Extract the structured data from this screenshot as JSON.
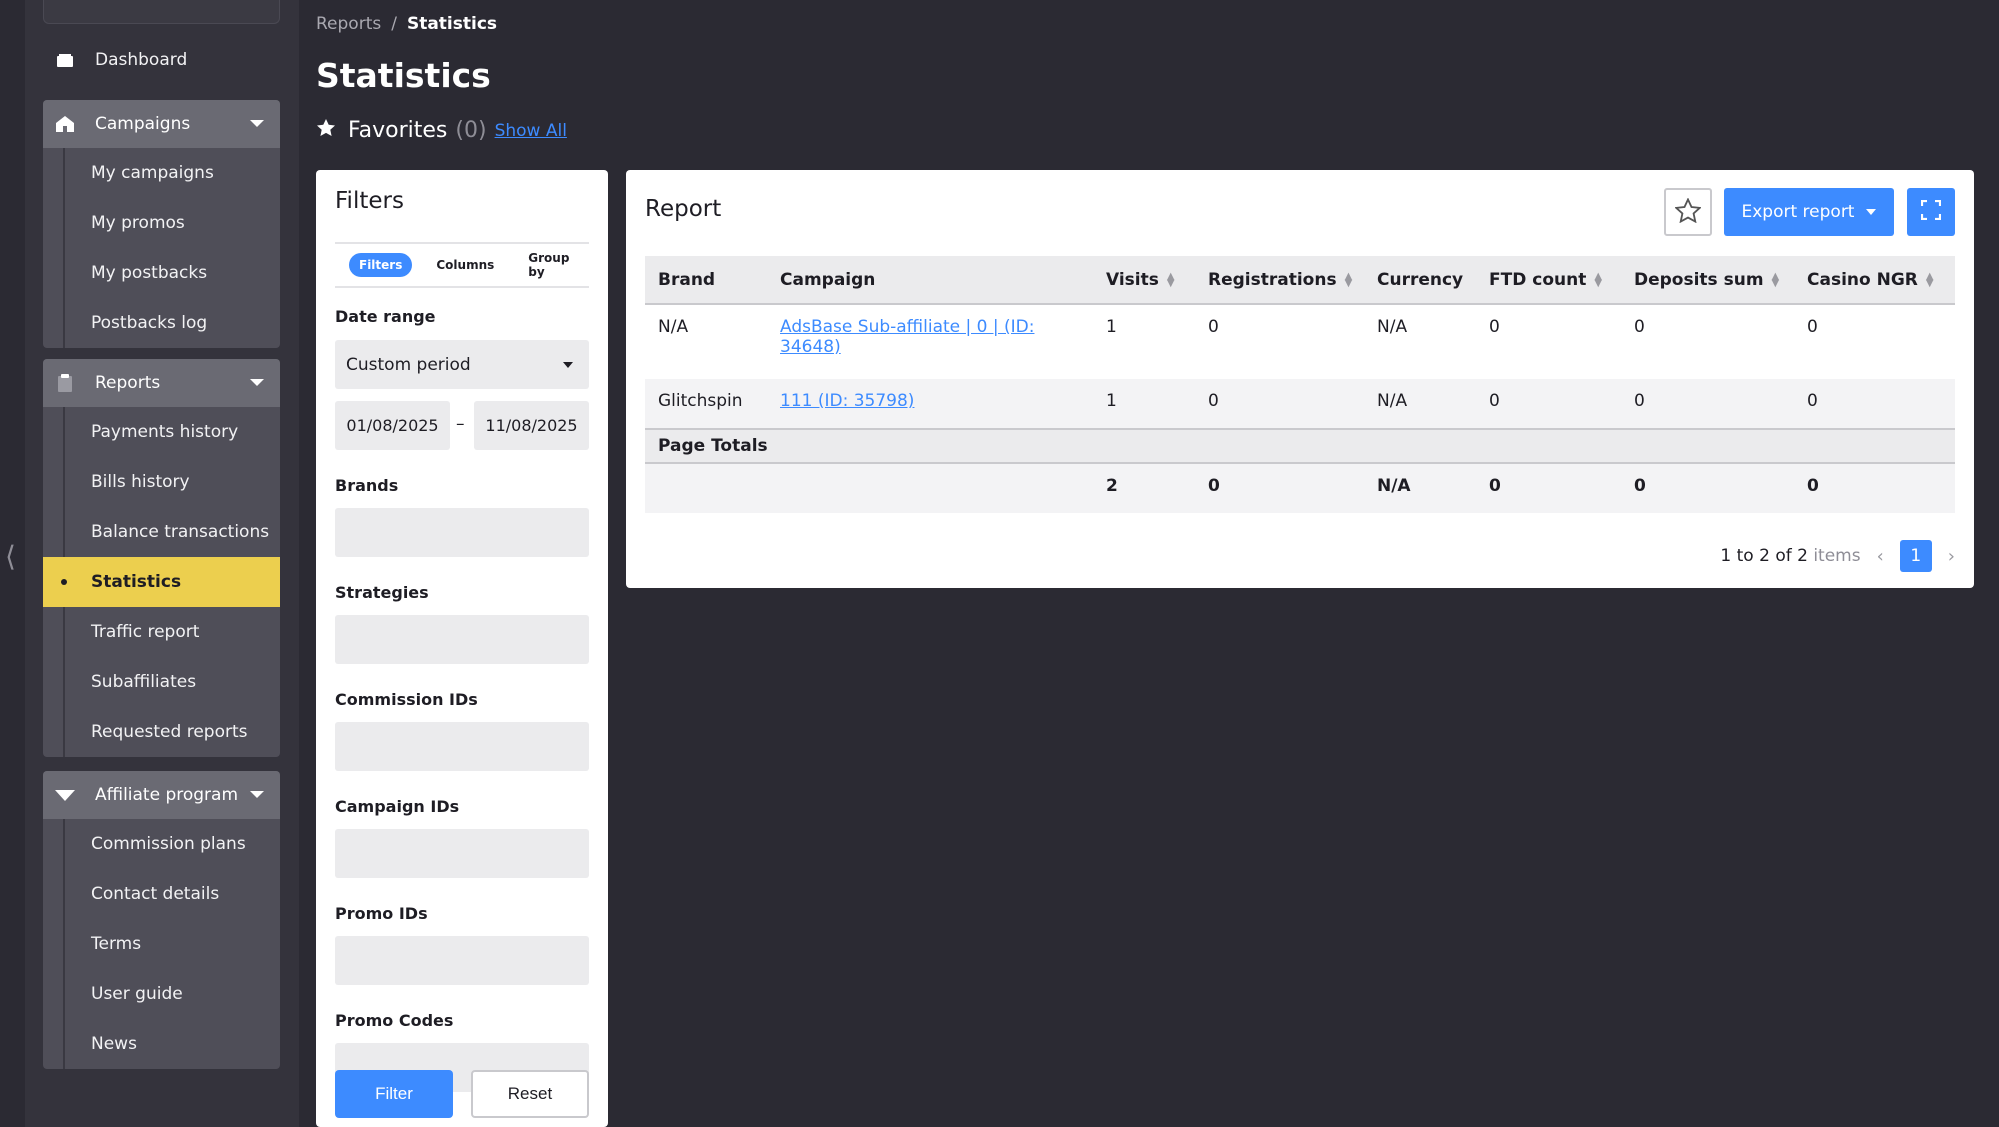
{
  "sidebar": {
    "dashboard": "Dashboard",
    "campaigns": {
      "label": "Campaigns",
      "items": [
        "My campaigns",
        "My promos",
        "My postbacks",
        "Postbacks log"
      ]
    },
    "reports": {
      "label": "Reports",
      "items": [
        "Payments history",
        "Bills history",
        "Balance transactions",
        "Statistics",
        "Traffic report",
        "Subaffiliates",
        "Requested reports"
      ]
    },
    "affiliate": {
      "label": "Affiliate program",
      "items": [
        "Commission plans",
        "Contact details",
        "Terms",
        "User guide",
        "News"
      ]
    }
  },
  "breadcrumb": {
    "parent": "Reports",
    "sep": "/",
    "current": "Statistics"
  },
  "page_title": "Statistics",
  "favorites": {
    "label": "Favorites",
    "count": "(0)",
    "show_all": "Show All"
  },
  "filters": {
    "title": "Filters",
    "tabs": [
      "Filters",
      "Columns",
      "Group by"
    ],
    "date_range_label": "Date range",
    "date_range_value": "Custom period",
    "date_from": "01/08/2025",
    "date_sep": "–",
    "date_to": "11/08/2025",
    "brands_label": "Brands",
    "strategies_label": "Strategies",
    "commission_ids_label": "Commission IDs",
    "campaign_ids_label": "Campaign IDs",
    "promo_ids_label": "Promo IDs",
    "promo_codes_label": "Promo Codes",
    "filter_button": "Filter",
    "reset_button": "Reset"
  },
  "report": {
    "title": "Report",
    "export_label": "Export report",
    "columns": [
      "Brand",
      "Campaign",
      "Visits",
      "Registrations",
      "Currency",
      "FTD count",
      "Deposits sum",
      "Casino NGR"
    ],
    "rows": [
      {
        "brand": "N/A",
        "campaign": "AdsBase Sub-affiliate | 0 | (ID: 34648)",
        "visits": "1",
        "registrations": "0",
        "currency": "N/A",
        "ftd": "0",
        "deposits": "0",
        "ngr": "0"
      },
      {
        "brand": "Glitchspin",
        "campaign": "111 (ID: 35798)",
        "visits": "1",
        "registrations": "0",
        "currency": "N/A",
        "ftd": "0",
        "deposits": "0",
        "ngr": "0"
      }
    ],
    "page_totals_label": "Page Totals",
    "totals": {
      "visits": "2",
      "registrations": "0",
      "currency": "N/A",
      "ftd": "0",
      "deposits": "0",
      "ngr": "0"
    },
    "pager": {
      "range": "1 to 2 of 2",
      "items": "items",
      "page": "1"
    }
  },
  "colors": {
    "accent": "#3d8bff",
    "active": "#eccf4e",
    "background": "#2b2a33"
  }
}
